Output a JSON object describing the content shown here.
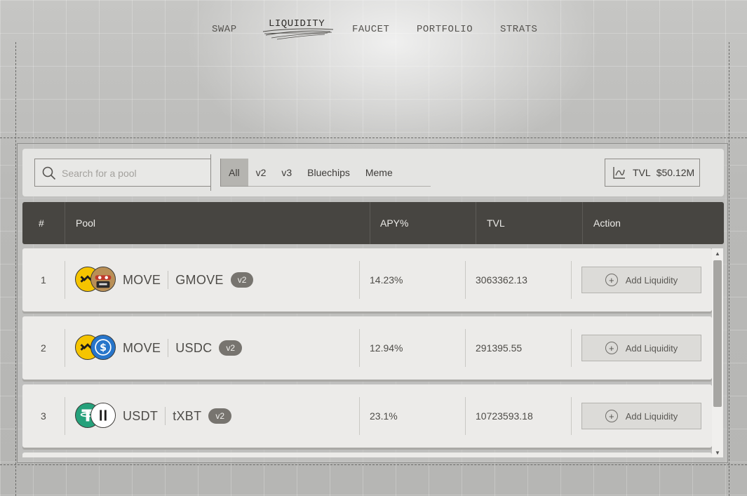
{
  "nav": {
    "items": [
      {
        "label": "SWAP"
      },
      {
        "label": "LIQUIDITY",
        "active": true
      },
      {
        "label": "FAUCET"
      },
      {
        "label": "PORTFOLIO"
      },
      {
        "label": "STRATS"
      }
    ]
  },
  "filters": {
    "search_placeholder": "Search for a pool",
    "tabs": [
      {
        "label": "All",
        "active": true
      },
      {
        "label": "v2"
      },
      {
        "label": "v3"
      },
      {
        "label": "Bluechips"
      },
      {
        "label": "Meme"
      }
    ],
    "tvl_label": "TVL",
    "tvl_value": "$50.12M"
  },
  "table": {
    "headers": {
      "index": "#",
      "pool": "Pool",
      "apy": "APY%",
      "tvl": "TVL",
      "action": "Action"
    },
    "rows": [
      {
        "index": "1",
        "token_a": "MOVE",
        "token_b": "GMOVE",
        "version": "v2",
        "apy": "14.23%",
        "tvl": "3063362.13",
        "action": "Add Liquidity"
      },
      {
        "index": "2",
        "token_a": "MOVE",
        "token_b": "USDC",
        "version": "v2",
        "apy": "12.94%",
        "tvl": "291395.55",
        "action": "Add Liquidity"
      },
      {
        "index": "3",
        "token_a": "USDT",
        "token_b": "tXBT",
        "version": "v2",
        "apy": "23.1%",
        "tvl": "10723593.18",
        "action": "Add Liquidity"
      }
    ]
  },
  "colors": {
    "header_bg": "#474541",
    "row_bg": "#ecebe9",
    "move_yellow": "#f5c400",
    "usdc_blue": "#2775ca",
    "usdt_teal": "#26a17b"
  }
}
